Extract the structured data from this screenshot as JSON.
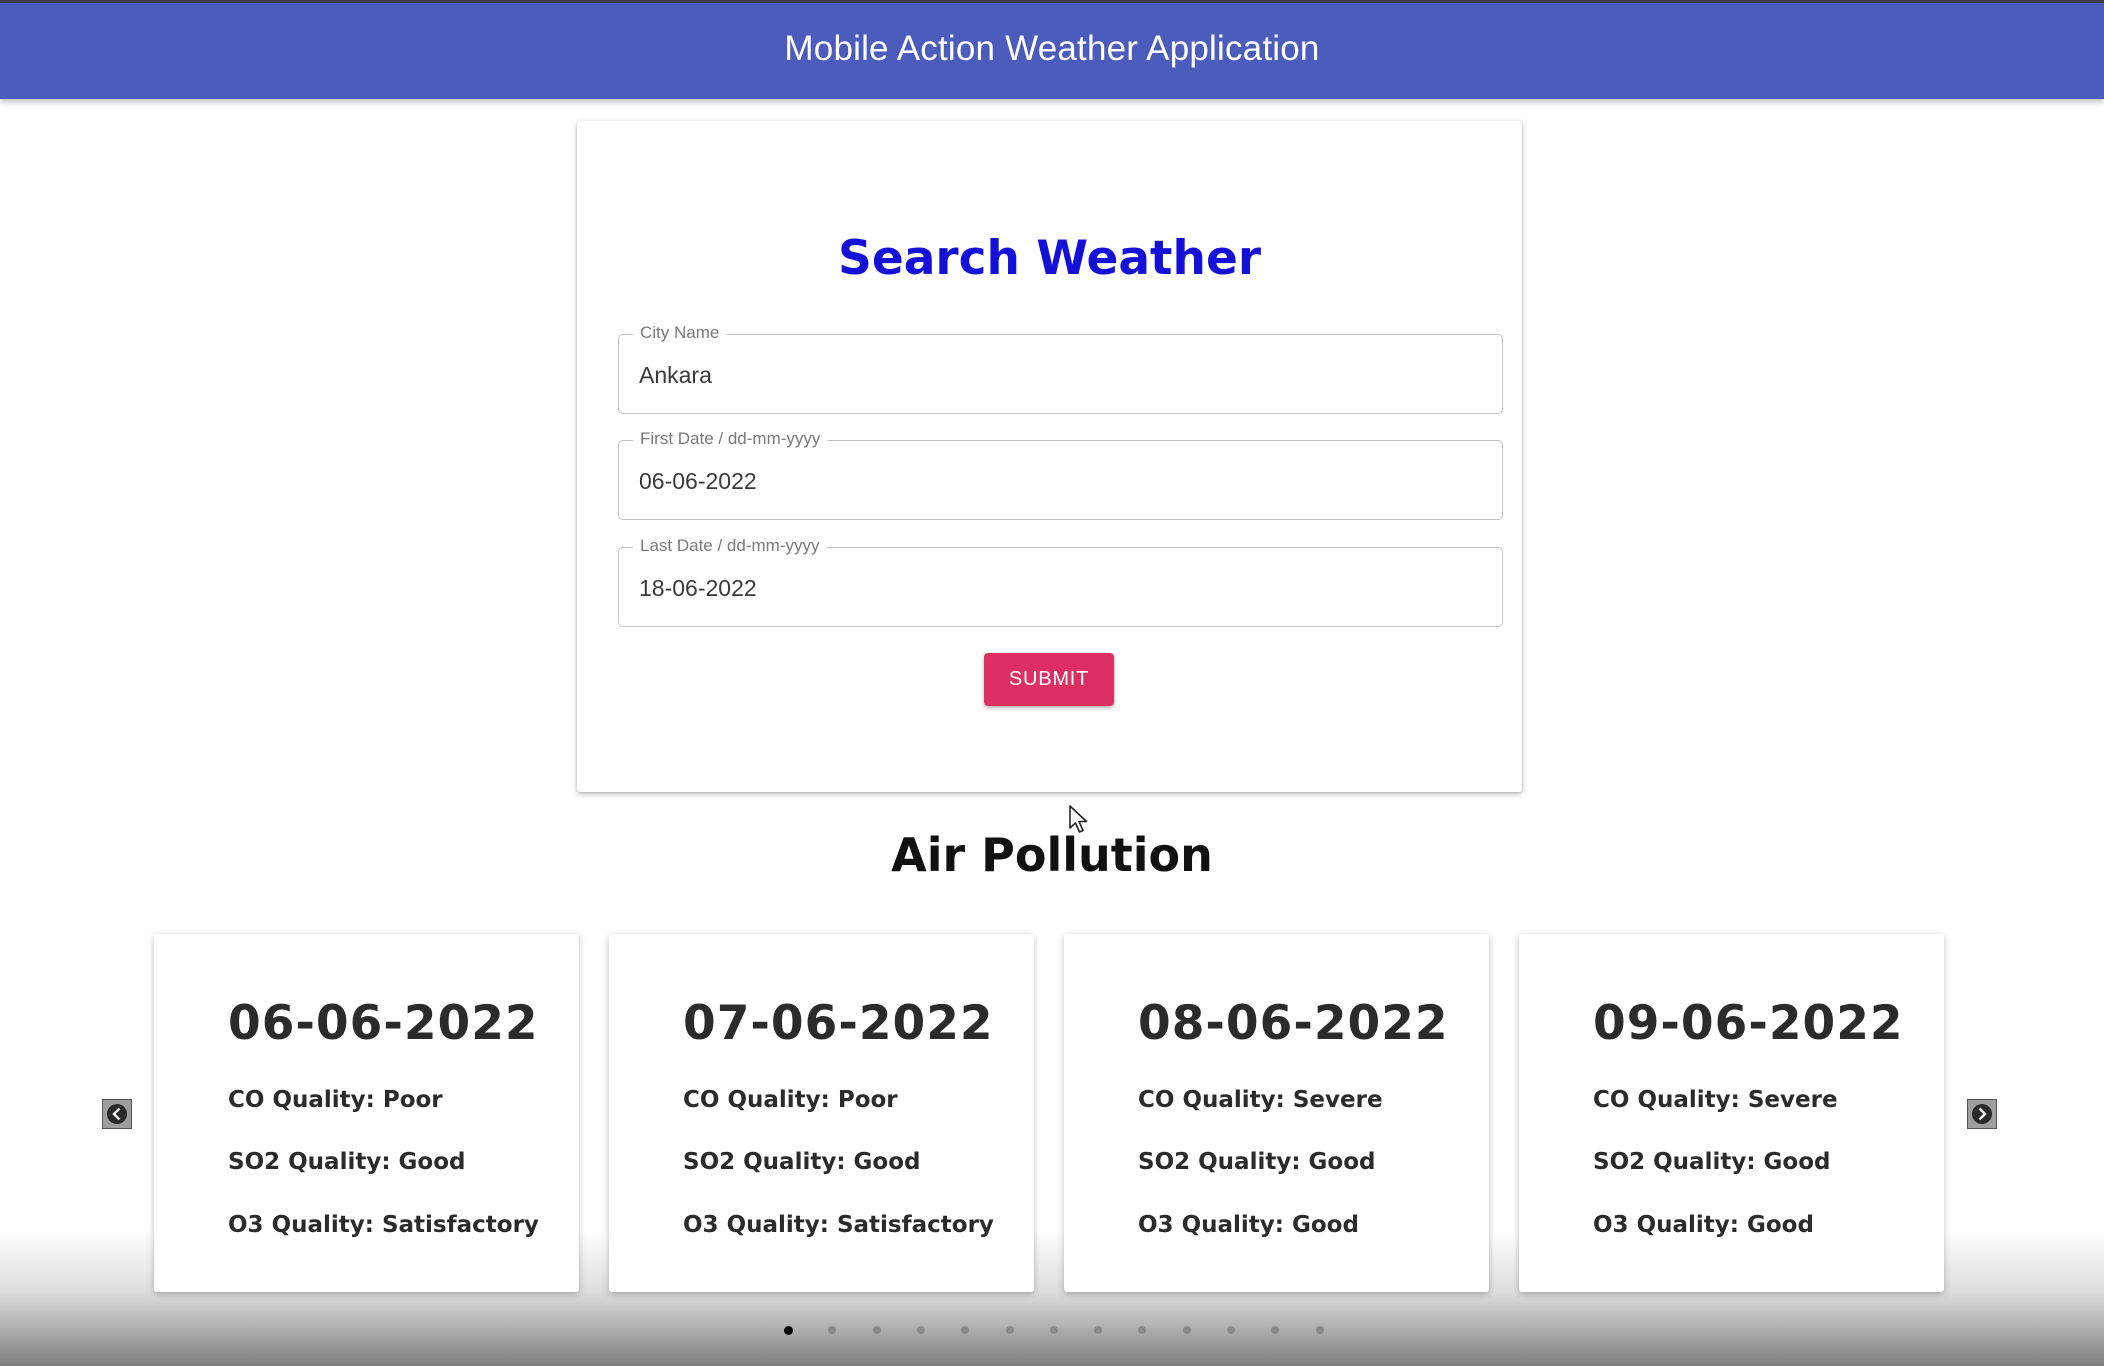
{
  "appbar": {
    "title": "Mobile Action Weather Application"
  },
  "search": {
    "title": "Search Weather",
    "fields": [
      {
        "label": "City Name",
        "value": "Ankara"
      },
      {
        "label": "First Date / dd-mm-yyyy",
        "value": "06-06-2022"
      },
      {
        "label": "Last Date / dd-mm-yyyy",
        "value": "18-06-2022"
      }
    ],
    "submit_label": "SUBMIT",
    "submit_color": "#dd2f64"
  },
  "pollution": {
    "title": "Air Pollution",
    "cards": [
      {
        "date": "06-06-2022",
        "co": "CO Quality: Poor",
        "so2": "SO2 Quality: Good",
        "o3": "O3 Quality: Satisfactory"
      },
      {
        "date": "07-06-2022",
        "co": "CO Quality: Poor",
        "so2": "SO2 Quality: Good",
        "o3": "O3 Quality: Satisfactory"
      },
      {
        "date": "08-06-2022",
        "co": "CO Quality: Severe",
        "so2": "SO2 Quality: Good",
        "o3": "O3 Quality: Good"
      },
      {
        "date": "09-06-2022",
        "co": "CO Quality: Severe",
        "so2": "SO2 Quality: Good",
        "o3": "O3 Quality: Good"
      }
    ],
    "carousel": {
      "page_count": 13,
      "active_page": 1
    }
  },
  "colors": {
    "appbar": "#4b5cbc",
    "search_title": "#1410d8"
  },
  "icons": {
    "prev": "chevron-left-icon",
    "next": "chevron-right-icon",
    "pointer": "mouse-cursor-icon"
  }
}
